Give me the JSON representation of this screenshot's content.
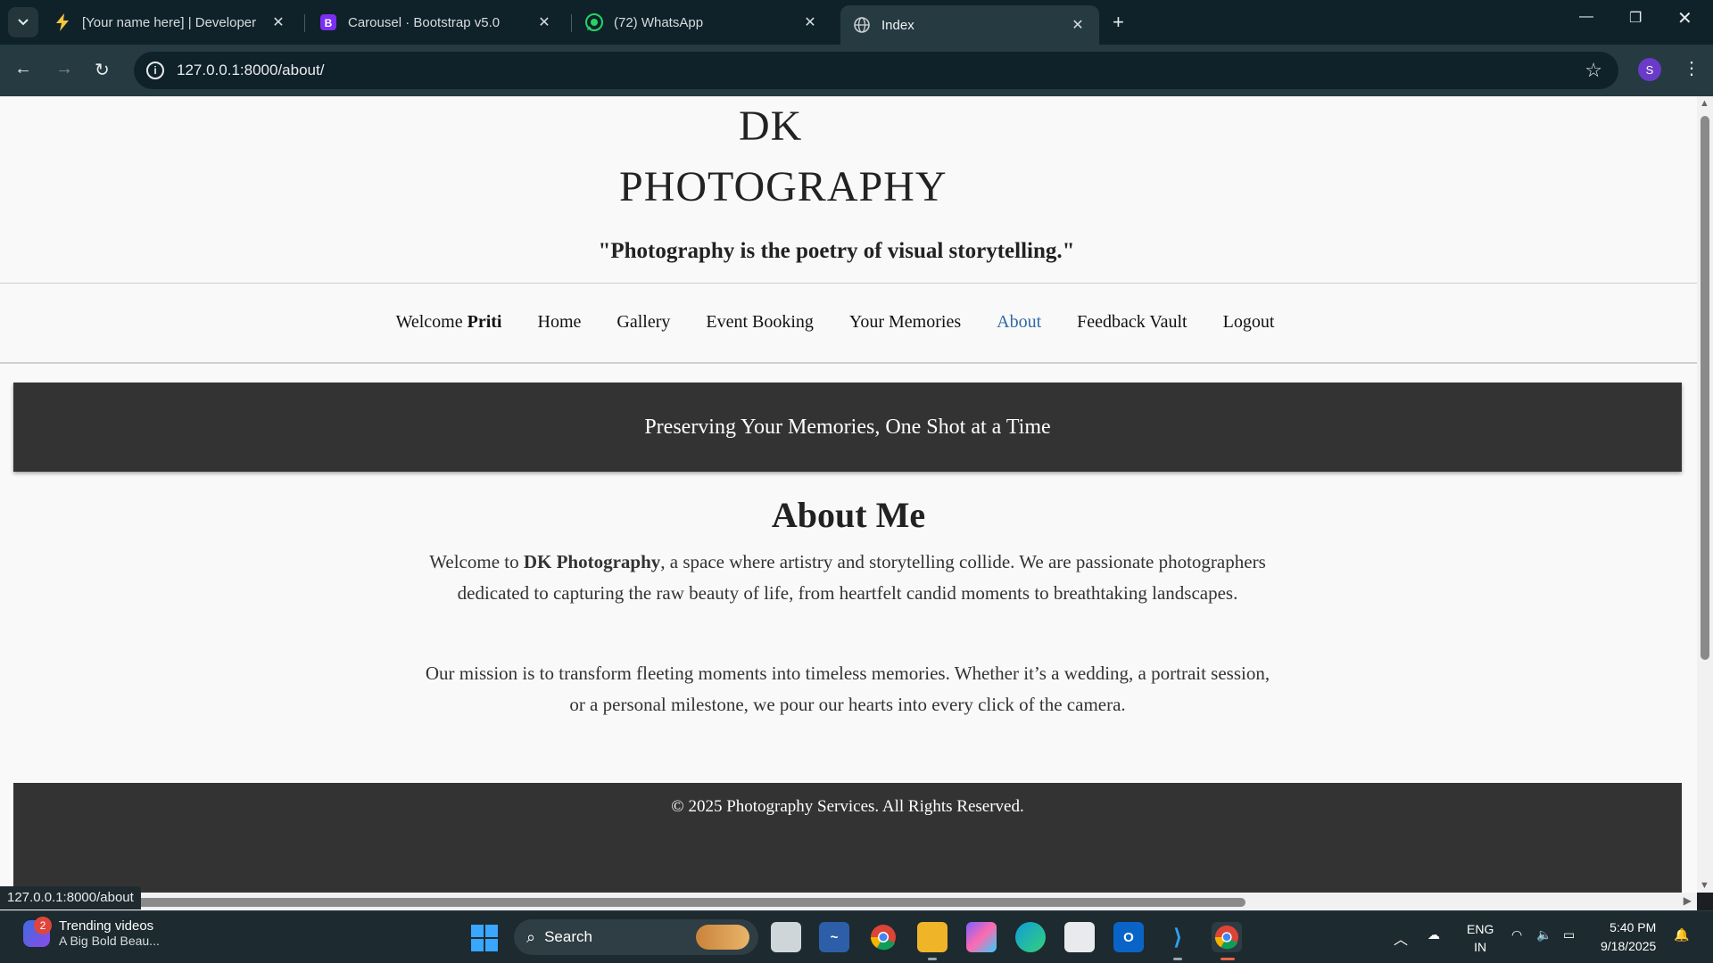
{
  "browser": {
    "tabs": [
      {
        "title": "[Your name here] | Developer",
        "icon": "bolt-icon"
      },
      {
        "title": "Carousel · Bootstrap v5.0",
        "icon": "bootstrap-icon"
      },
      {
        "title": "(72) WhatsApp",
        "icon": "whatsapp-icon"
      },
      {
        "title": "Index",
        "icon": "globe-icon",
        "active": true
      }
    ],
    "url": "127.0.0.1:8000/about/",
    "profile_initial": "S",
    "status_url": "127.0.0.1:8000/about"
  },
  "site": {
    "brand_line1": "DK",
    "brand_line2": "PHOTOGRAPHY",
    "tagline": "\"Photography is the poetry of visual storytelling.\"",
    "nav": {
      "welcome_prefix": "Welcome",
      "user": "Priti",
      "items": [
        "Home",
        "Gallery",
        "Event Booking",
        "Your Memories",
        "About",
        "Feedback Vault",
        "Logout"
      ],
      "active": "About"
    },
    "hero_text": "Preserving Your Memories, One Shot at a Time",
    "about": {
      "title": "About Me",
      "p1_before": "Welcome to",
      "p1_bold": "DK Photography",
      "p1_after": ", a space where artistry and storytelling collide. We are passionate photographers dedicated to capturing the raw beauty of life, from heartfelt candid moments to breathtaking landscapes.",
      "p2": "Our mission is to transform fleeting moments into timeless memories. Whether it’s a wedding, a portrait session, or a personal milestone, we pour our hearts into every click of the camera."
    },
    "footer": "© 2025 Photography Services. All Rights Reserved.",
    "accent_color": "#2f6aa3",
    "dark_band_color": "#333333"
  },
  "taskbar": {
    "widget_badge": "2",
    "widget_title": "Trending videos",
    "widget_sub": "A Big Bold Beau...",
    "search_label": "Search",
    "lang_line1": "ENG",
    "lang_line2": "IN",
    "time": "5:40 PM",
    "date": "9/18/2025",
    "chrome_profile_initial": "S"
  }
}
